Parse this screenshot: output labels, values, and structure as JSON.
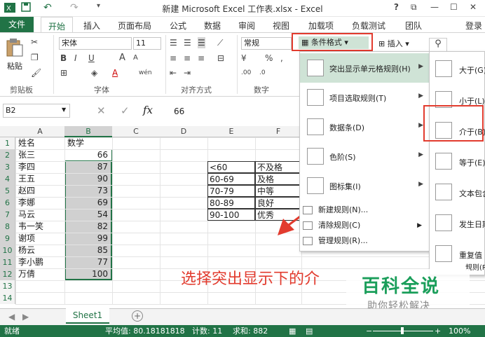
{
  "window": {
    "title": "新建 Microsoft Excel 工作表.xlsx - Excel",
    "help": "?",
    "restore": "⧉",
    "min": "—",
    "max": "☐",
    "close": "✕"
  },
  "menu_tabs": [
    "开始",
    "插入",
    "页面布局",
    "公式",
    "数据",
    "审阅",
    "视图",
    "加载项",
    "负载测试",
    "团队"
  ],
  "file_tab": "文件",
  "login": "登录",
  "ribbon": {
    "paste": "粘贴",
    "clipboard": "剪贴板",
    "font_name": "宋体",
    "font_size": "11",
    "bold": "B",
    "italic": "I",
    "underline": "U",
    "grow": "A",
    "shrink": "A",
    "font_color": "A",
    "wen": "wén",
    "font_group": "字体",
    "align_group": "对齐方式",
    "number_format": "常规",
    "percent": "%",
    "comma": ",",
    "number_group": "数字",
    "cond_format": "条件格式",
    "insert": "插入"
  },
  "formula": {
    "namebox": "B2",
    "fx": "fx",
    "value": "66"
  },
  "columns": [
    "A",
    "B",
    "C",
    "D",
    "E",
    "F"
  ],
  "rows": [
    "1",
    "2",
    "3",
    "4",
    "5",
    "6",
    "7",
    "8",
    "9",
    "10",
    "11",
    "12",
    "13",
    "14"
  ],
  "table": {
    "header": [
      "姓名",
      "数学"
    ],
    "names": [
      "张三",
      "李四",
      "王五",
      "赵四",
      "李娜",
      "马云",
      "韦一笑",
      "谢项",
      "杨云",
      "李小鹏",
      "万倩"
    ],
    "scores": [
      "66",
      "87",
      "90",
      "73",
      "69",
      "54",
      "82",
      "99",
      "85",
      "77",
      "100"
    ]
  },
  "grades": [
    [
      "<60",
      "不及格"
    ],
    [
      "60-69",
      "及格"
    ],
    [
      "70-79",
      "中等"
    ],
    [
      "80-89",
      "良好"
    ],
    [
      "90-100",
      "优秀"
    ]
  ],
  "cf_menu": {
    "items": [
      "突出显示单元格规则(H)",
      "项目选取规则(T)",
      "数据条(D)",
      "色阶(S)",
      "图标集(I)"
    ],
    "small": [
      "新建规则(N)...",
      "清除规则(C)",
      "管理规则(R)..."
    ]
  },
  "submenu": {
    "items": [
      "大于(G)",
      "小于(L)",
      "介于(B)",
      "等于(E)",
      "文本包含",
      "发生日期",
      "重复值"
    ],
    "more": "规则(R)"
  },
  "annotation": "选择突出显示下的介",
  "watermark": {
    "title": "百科全说",
    "subtitle": "助你轻松解决"
  },
  "sheet": {
    "tab": "Sheet1",
    "add": "+"
  },
  "status": {
    "ready": "就绪",
    "avg": "平均值: 80.18181818",
    "count": "计数: 11",
    "sum": "求和: 882",
    "zoom": "100%"
  },
  "colors": {
    "accent": "#217346",
    "red": "#e23b2e",
    "selection": "#d0d0d0"
  }
}
